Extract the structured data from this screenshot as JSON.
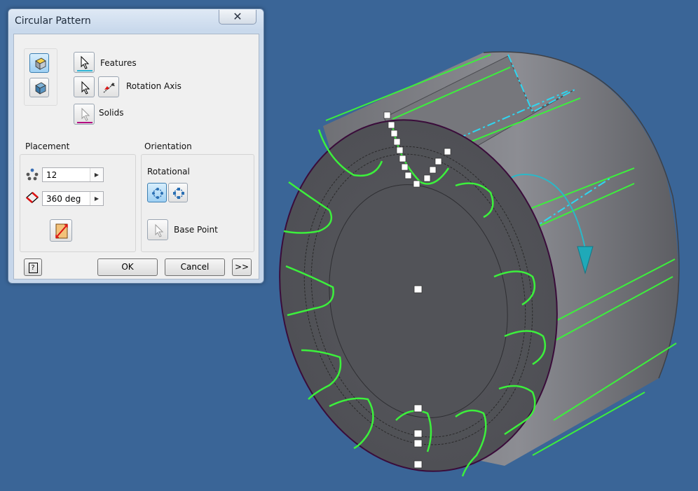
{
  "dialog": {
    "title": "Circular Pattern",
    "close_glyph": "✕",
    "selection": {
      "features_label": "Features",
      "rotation_axis_label": "Rotation Axis",
      "solids_label": "Solids"
    },
    "placement": {
      "heading": "Placement",
      "count_value": "12",
      "angle_value": "360 deg"
    },
    "orientation": {
      "heading": "Orientation",
      "rotational_label": "Rotational",
      "base_point_label": "Base Point"
    },
    "buttons": {
      "ok": "OK",
      "cancel": "Cancel",
      "more": ">>",
      "help_glyph": "?"
    }
  },
  "icons": {
    "pattern_features_mode": "pattern-features-icon",
    "pattern_solids_mode": "pattern-solids-icon",
    "select_arrow": "select-arrow-icon",
    "flip_axis": "flip-axis-icon",
    "count": "count-dots-icon",
    "angle": "angle-icon",
    "midplane": "midplane-icon",
    "fixed_orientation": "fixed-icon",
    "rotational_orientation": "rotational-icon"
  },
  "colors": {
    "background": "#3a6597",
    "model_edge_highlight": "#3cf03c",
    "axis_highlight": "#2fd6f0",
    "solids_underline": "#b40080",
    "features_underline": "#2fb5d6"
  }
}
